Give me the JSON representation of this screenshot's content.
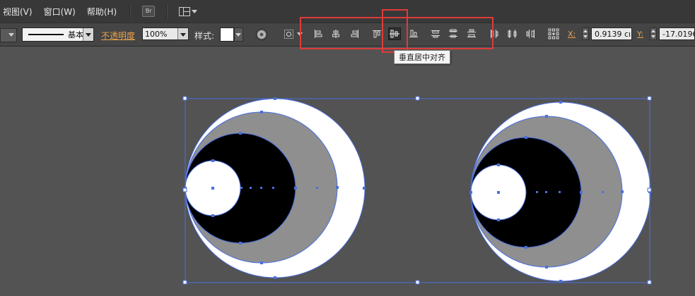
{
  "menubar": {
    "items": [
      "视图(V)",
      "窗口(W)",
      "帮助(H)"
    ],
    "bridge_label": "Br"
  },
  "controlbar": {
    "stroke_profile": "基本",
    "opacity_label": "不透明度",
    "opacity_value": "100%",
    "style_label": "样式:",
    "x_label": "X:",
    "x_value": "0.9139 cı",
    "y_label": "Y:",
    "y_value": "-17.0196"
  },
  "align_tools": [
    {
      "name": "horizontal-align-left",
      "icon": "align-left-icon"
    },
    {
      "name": "horizontal-align-center",
      "icon": "align-hcenter-icon"
    },
    {
      "name": "horizontal-align-right",
      "icon": "align-right-icon"
    },
    {
      "name": "vertical-align-top",
      "icon": "align-top-icon"
    },
    {
      "name": "vertical-align-center",
      "icon": "align-vcenter-icon",
      "active": true
    },
    {
      "name": "vertical-align-bottom",
      "icon": "align-bottom-icon"
    },
    {
      "name": "vertical-distribute-top",
      "icon": "distribute-top-icon"
    },
    {
      "name": "vertical-distribute-center",
      "icon": "distribute-vcenter-icon"
    },
    {
      "name": "vertical-distribute-bottom",
      "icon": "distribute-bottom-icon"
    },
    {
      "name": "horizontal-distribute-left",
      "icon": "distribute-left-icon"
    },
    {
      "name": "horizontal-distribute-center",
      "icon": "distribute-hcenter-icon"
    },
    {
      "name": "horizontal-distribute-right",
      "icon": "distribute-right-icon"
    },
    {
      "name": "transform-reference-point",
      "icon": "reference-point-icon"
    }
  ],
  "tooltip": {
    "text": "垂直居中对齐"
  },
  "colors": {
    "highlight": "#e03b3b",
    "selection": "#4a6fe0",
    "canvas": "#535353",
    "shape_white": "#ffffff",
    "shape_gray": "#8f8f8f",
    "shape_black": "#000000"
  }
}
